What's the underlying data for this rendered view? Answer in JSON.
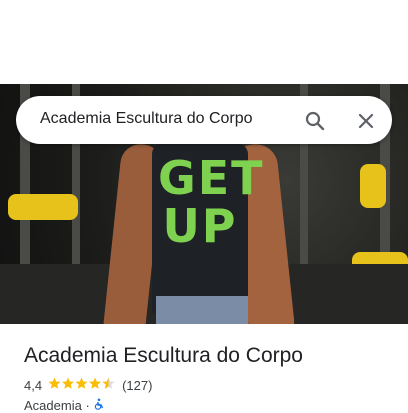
{
  "search": {
    "query": "Academia Escultura do Corpo",
    "search_icon": "search-icon",
    "close_icon": "close-icon"
  },
  "photo": {
    "shirt_text": "GET UP"
  },
  "place": {
    "name": "Academia Escultura do Corpo",
    "rating": "4,4",
    "stars": 4.5,
    "reviews": "(127)",
    "category": "Academia",
    "separator": "·",
    "accessibility_icon": "wheelchair-icon"
  },
  "colors": {
    "star": "#fbbc04",
    "accessible": "#1a73e8"
  }
}
